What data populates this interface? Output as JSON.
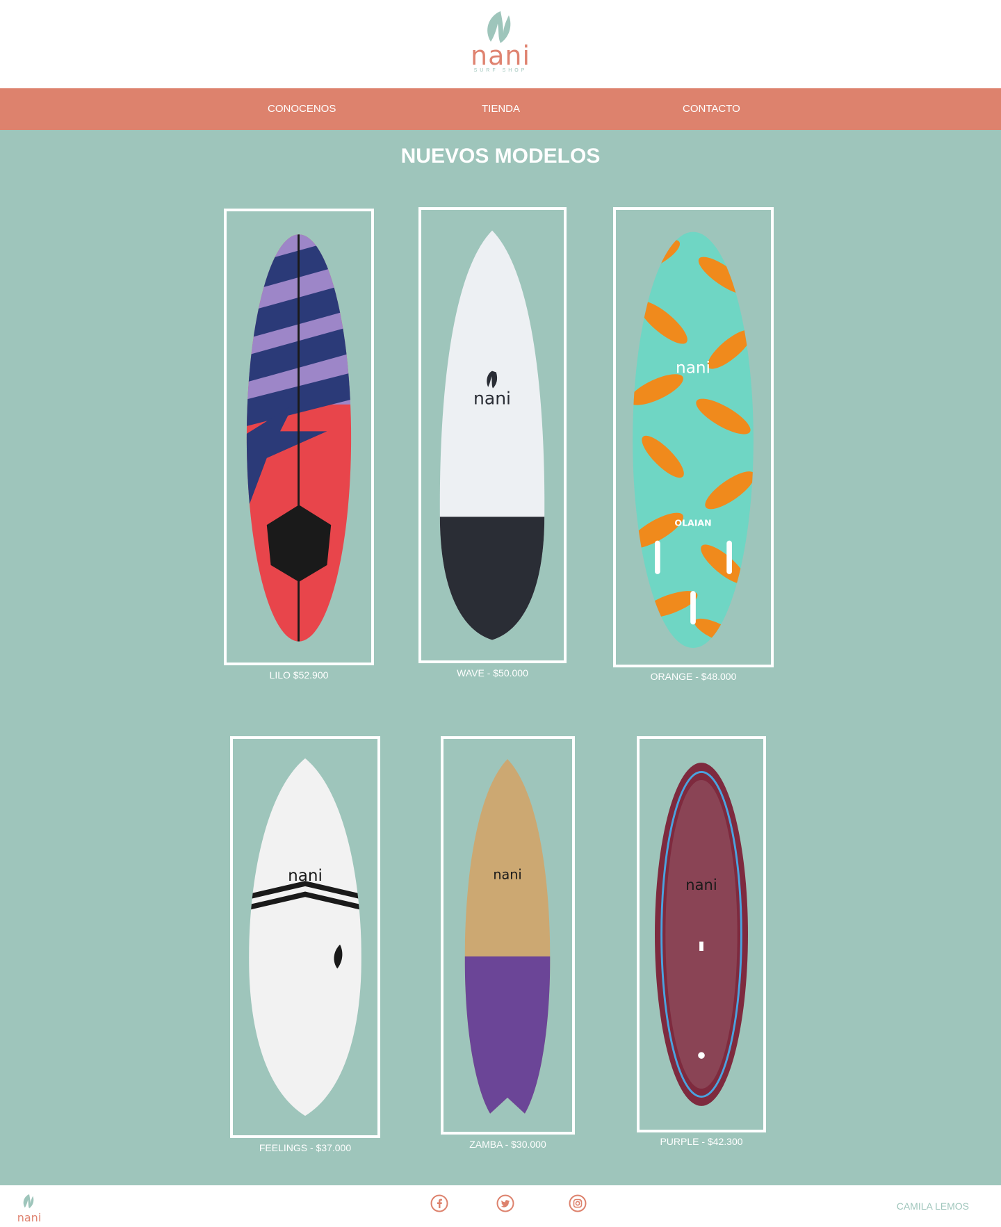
{
  "brand": {
    "name": "nani",
    "tagline": "SURF SHOP"
  },
  "nav": {
    "items": [
      "CONOCENOS",
      "TIENDA",
      "CONTACTO"
    ]
  },
  "section": {
    "title": "NUEVOS MODELOS"
  },
  "products": [
    {
      "label": "LILO $52.900"
    },
    {
      "label": "WAVE - $50.000"
    },
    {
      "label": "ORANGE - $48.000",
      "print": "OLAIAN"
    },
    {
      "label": "FEELINGS - $37.000"
    },
    {
      "label": "ZAMBA - $30.000"
    },
    {
      "label": "PURPLE - $42.300"
    }
  ],
  "footer": {
    "brand": "nani",
    "social": [
      "facebook-icon",
      "twitter-icon",
      "instagram-icon"
    ],
    "credit": "CAMILA LEMOS"
  },
  "colors": {
    "teal": "#9ec5bb",
    "coral": "#dd826d",
    "white": "#ffffff"
  }
}
